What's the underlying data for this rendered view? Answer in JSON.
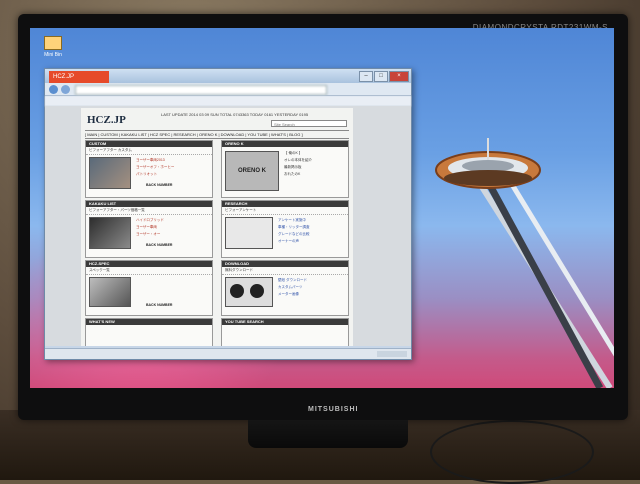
{
  "monitor": {
    "brand": "MITSUBISHI",
    "model": "DIAMONDCRYSTA RDT231WM-S"
  },
  "desktop": {
    "icon_label": "Mini Bin"
  },
  "browser": {
    "tab_title": "HCZ.JP"
  },
  "site": {
    "logo": "HCZ.JP",
    "header_info": "LAST UPDATE 2014 03 09 SUN  TOTAL 0743363  TODAY 0161  YESTERDAY 0195",
    "search_placeholder": "Site Search",
    "nav_links": "[ MAIN | CUSTOM | KAKAKU LIST | HCZ SPEC | RESEARCH | ORENO K | DOWNLOAD | YOU TUBE | WHAT'S | BLOG ]",
    "sections": {
      "custom": {
        "title": "CUSTOM",
        "subtitle": "ビフォーアフター カスタム",
        "links": [
          "ヨーザー車両2013",
          "ヨーザーオフ・ホーヒー",
          "パトリオット"
        ],
        "back": "BACK NUMBER"
      },
      "oreno": {
        "title": "ORENO K",
        "badge": "ORENO K",
        "links": [
          "【 俺のK 】",
          "オレの本体を紹介",
          "最新掲示板",
          "おれたのK"
        ]
      },
      "kakaku": {
        "title": "KAKAKU LIST",
        "subtitle": "ビフォーアフター・パーツ価格一覧",
        "links": [
          "ハイドロブリッド",
          "ヨーザー車両",
          "ヨーザー・オー"
        ],
        "back": "BACK NUMBER"
      },
      "research": {
        "title": "RESEARCH",
        "subtitle": "ビフォーアンケート",
        "links": [
          "アンケート実施中",
          "車種・リッター調査",
          "グレードなどの比較",
          "オーナーの声"
        ]
      },
      "spec": {
        "title": "HCZ-SPEC",
        "subtitle": "スペック一覧",
        "back": "BACK NUMBER"
      },
      "download": {
        "title": "DOWNLOAD",
        "subtitle": "無料ダウンロード",
        "links": [
          "壁紙 ダウンロード",
          "カスタムパーツ",
          "メーター画像"
        ]
      },
      "whatsnew": {
        "title": "WHAT'S NEW"
      },
      "youtube": {
        "title": "YOU TUBE SEARCH"
      }
    }
  },
  "colors": {
    "tab": "#e64a2a",
    "sky_top": "#4f86d6",
    "sky_bottom": "#d04a7a"
  }
}
